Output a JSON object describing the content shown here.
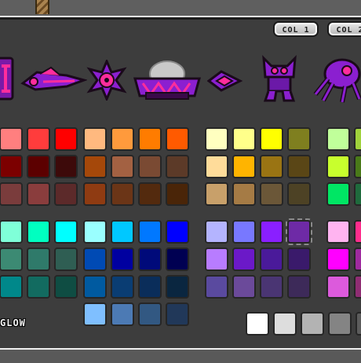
{
  "buttons": {
    "col1_label": "COL 1",
    "col2_label": "COL 2"
  },
  "labels": {
    "glow": "GLOW"
  },
  "icons": {
    "preview_icons": [
      "cube-icon",
      "ship-icon",
      "ball-icon",
      "ufo-icon",
      "wave-icon",
      "robot-icon",
      "spider-icon"
    ],
    "primary_color": "#8b1fd0",
    "secondary_color": "#ff2d9c"
  },
  "palette": {
    "groups": [
      [
        "#ff7f7f",
        "#ff3c3c",
        "#ff0000",
        "#7c0000",
        "#5c0000",
        "#3d0a0a",
        "#7a3c3c",
        "#8a3d3d",
        "#5c2a2a"
      ],
      [
        "#ffb97f",
        "#ff9a3c",
        "#ff7c00",
        "#ff5a00",
        "#a5480a",
        "#a36142",
        "#7a4a33",
        "#5c3a28",
        "#8f3b12",
        "#6b3517",
        "#532a0e",
        "#4a2508"
      ],
      [
        "#ffffc0",
        "#ffff8a",
        "#ffff00",
        "#7f7f1f",
        "#ffdc9a",
        "#ffb400",
        "#9a7413",
        "#5a4616",
        "#c8a06a",
        "#a57b45",
        "#6b5738",
        "#4d4225"
      ],
      [
        "#c0ff9a",
        "#a0d23c",
        "#c8ff2d",
        "#4a7a19",
        "#00e664",
        "#1f6b3d"
      ],
      [
        "#7fffd8",
        "#00ffc0",
        "#00ffff",
        "#3c8a73",
        "#2f7a6a",
        "#2f5e53",
        "#00888a",
        "#126b60",
        "#0f4d43"
      ],
      [
        "#9affff",
        "#00c8ff",
        "#0078ff",
        "#0000ff",
        "#004ab4",
        "#0000a0",
        "#000a7a",
        "#000052",
        "#005aa0",
        "#0a3d73",
        "#0a2d5a",
        "#0a2640",
        "#7fbfff",
        "#4c7ab4",
        "#325882",
        "#213859"
      ],
      [
        "#b4b4ff",
        "#7878ff",
        "#8a1fff",
        "#6e2aa6",
        "#b87cff",
        "#6b19c8",
        "#4a1a9a",
        "#3a1a6b",
        "#5a4a9f",
        "#6b4a9a",
        "#4a3573",
        "#3d2a59"
      ],
      [
        "#ffb4f0",
        "#ff2d8c",
        "#ff00ff",
        "#9f2a9f",
        "#dc5adc",
        "#8f2d73"
      ],
      [
        "#ffffff",
        "#dddddd",
        "#b3b3b3",
        "#848484",
        "#5c5c5c"
      ]
    ]
  }
}
